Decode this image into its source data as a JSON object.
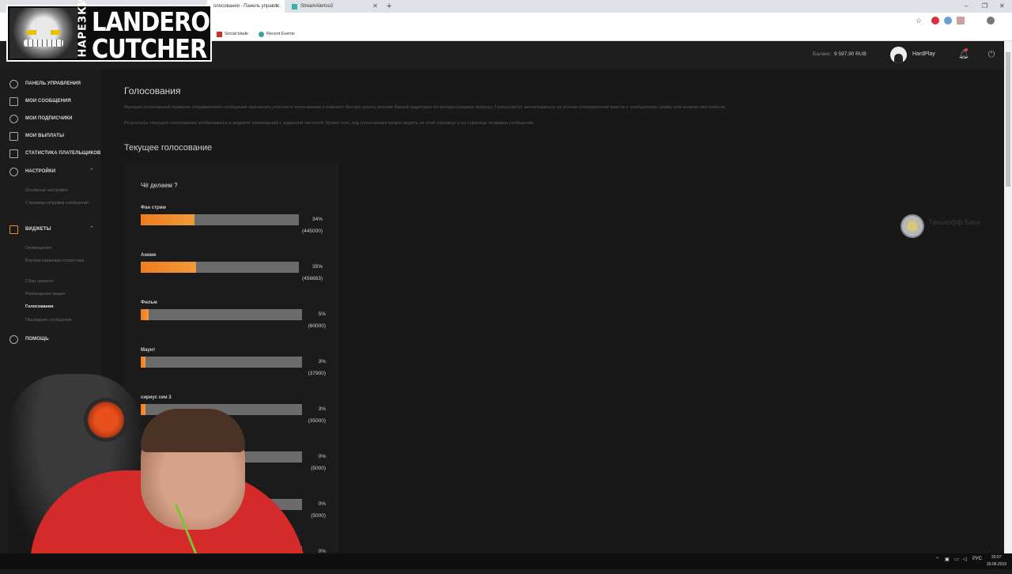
{
  "browser": {
    "active_tab": "олосования - Панель управл...",
    "second_tab": "StreamAlertso2",
    "bookmarks": [
      "Social blade",
      "Recent Events"
    ]
  },
  "overlay": {
    "logo_line1": "LANDEROK",
    "logo_line2": "CUTCHER",
    "logo_side": "НАРЕЗКИ"
  },
  "header": {
    "balance_label": "Баланс:",
    "balance_value": "9 597,90 RUB",
    "username": "HardPlay"
  },
  "sidebar": {
    "items": [
      {
        "label": "ПАНЕЛЬ УПРАВЛЕНИЯ"
      },
      {
        "label": "МОИ СООБЩЕНИЯ"
      },
      {
        "label": "МОИ ПОДПИСЧИКИ"
      },
      {
        "label": "МОИ ВЫПЛАТЫ"
      },
      {
        "label": "СТАТИСТИКА ПЛАТЕЛЬЩИКОВ"
      },
      {
        "label": "НАСТРОЙКИ"
      },
      {
        "label": "ВИДЖЕТЫ"
      },
      {
        "label": "ПОМОЩЬ"
      }
    ],
    "settings_sub": [
      "Основные настройки",
      "Страница отправки сообщений"
    ],
    "widgets_sub": [
      "Оповещения",
      "Внутристримовая статистика",
      "Сбор средств",
      "Размещение медиа",
      "Голосования",
      "Последние сообщения"
    ]
  },
  "main": {
    "title": "Голосования",
    "desc1": "Функция голосований позволит отправителям сообщений принимать участие в голосовании и поможет быстро узнать мнение Вашей аудитории по интересующему вопросу. Голоса могут засчитываться на основе отправленной вместе с сообщением суммы или количества голосов.",
    "desc2": "Результаты текущего голосования отображается в виджете оповещений с заданной частотой. Кроме того, ход голосования можно видеть на этой странице и на странице отправки сообщений.",
    "section_title": "Текущее голосование",
    "question": "Чё делаем ?",
    "options": [
      {
        "label": "Фан стрим",
        "pct": "34%",
        "count": "(445000)",
        "share": 34
      },
      {
        "label": "Аниме",
        "pct": "35%",
        "count": "(456663)",
        "share": 35
      },
      {
        "label": "Фильм",
        "pct": "5%",
        "count": "(60000)",
        "share": 5
      },
      {
        "label": "Маунт",
        "pct": "3%",
        "count": "(37900)",
        "share": 3
      },
      {
        "label": "сириус сем 3",
        "pct": "3%",
        "count": "(35000)",
        "share": 3
      },
      {
        "label": "",
        "pct": "0%",
        "count": "(5000)",
        "share": 0
      },
      {
        "label": "",
        "pct": "0%",
        "count": "(5000)",
        "share": 0
      },
      {
        "label": "",
        "pct": "0%",
        "count": "",
        "share": 0
      }
    ],
    "bank_text": "Тинькофф Банк"
  },
  "taskbar": {
    "lang": "РУС",
    "time": "20:07",
    "date": "30.06.2019"
  }
}
